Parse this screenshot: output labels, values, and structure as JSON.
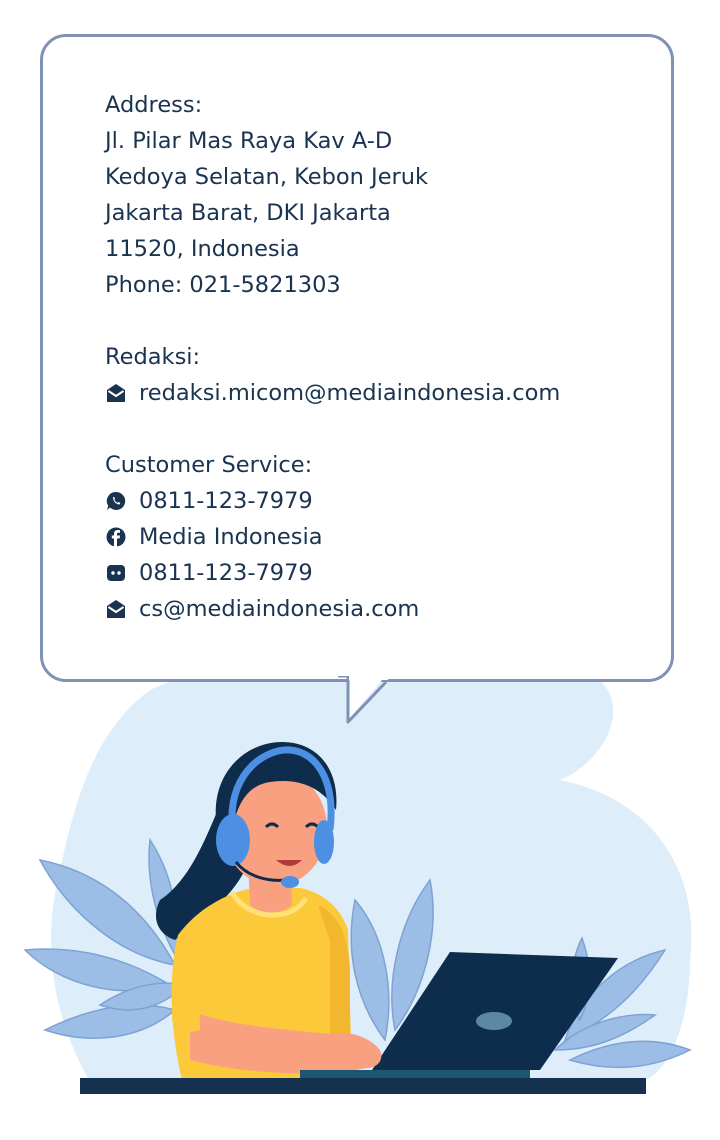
{
  "contact_card": {
    "address": {
      "heading": "Address:",
      "lines": [
        "Jl. Pilar Mas Raya Kav A-D",
        "Kedoya Selatan, Kebon Jeruk",
        "Jakarta Barat, DKI Jakarta",
        "11520, Indonesia"
      ],
      "phone": "Phone: 021-5821303"
    },
    "redaksi": {
      "heading": "Redaksi:",
      "email": {
        "icon": "envelope-icon",
        "text": "redaksi.micom@mediaindonesia.com"
      }
    },
    "customer_service": {
      "heading": "Customer Service:",
      "items": [
        {
          "icon": "whatsapp-icon",
          "text": "0811-123-7979"
        },
        {
          "icon": "facebook-icon",
          "text": "Media Indonesia"
        },
        {
          "icon": "chat-icon",
          "text": "0811-123-7979"
        },
        {
          "icon": "envelope-icon",
          "text": "cs@mediaindonesia.com"
        }
      ]
    }
  },
  "illustration": {
    "name": "customer-service-agent-illustration",
    "colors": {
      "background_blob": "#ddeefa",
      "leaves": "#9cbde6",
      "shirt": "#fcc93b",
      "skin": "#f8a080",
      "hair": "#0e2d4d",
      "headset": "#4d90e3",
      "laptop": "#0e2d4d",
      "desk": "#14324f"
    }
  },
  "colors": {
    "text": "#1a3350",
    "border": "#7f91b4"
  }
}
